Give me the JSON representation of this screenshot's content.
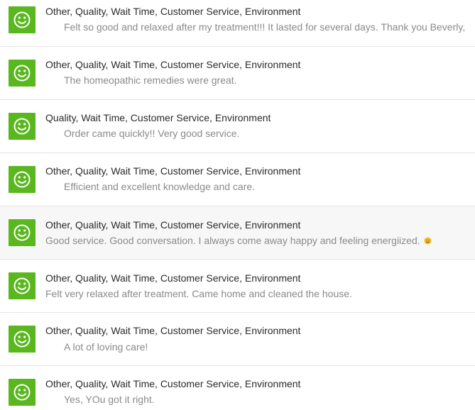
{
  "colors": {
    "smiley_bg": "#5ab71f",
    "category_text": "#2b2b2b",
    "comment_text": "#8a8a8a",
    "divider": "#e4e4e4"
  },
  "feedback": [
    {
      "icon": "smiley-face-icon",
      "categories": "Other, Quality, Wait Time, Customer Service, Environment",
      "comment": "Felt so good and relaxed after my treatment!!! It lasted for several days. Thank you Beverly,"
    },
    {
      "icon": "smiley-face-icon",
      "categories": "Other, Quality, Wait Time, Customer Service, Environment",
      "comment": "The homeopathic remedies were great."
    },
    {
      "icon": "smiley-face-icon",
      "categories": "Quality, Wait Time, Customer Service, Environment",
      "comment": "Order came quickly!! Very good service."
    },
    {
      "icon": "smiley-face-icon",
      "categories": "Other, Quality, Wait Time, Customer Service, Environment",
      "comment": "Efficient and excellent knowledge and care."
    },
    {
      "icon": "smiley-face-icon",
      "categories": "Other, Quality, Wait Time, Customer Service, Environment",
      "comment": "Good service. Good conversation. I always come away happy and feeling energiized."
    },
    {
      "icon": "smiley-face-icon",
      "categories": "Other, Quality, Wait Time, Customer Service, Environment",
      "comment": "Felt very relaxed after treatment. Came home and cleaned the house."
    },
    {
      "icon": "smiley-face-icon",
      "categories": "Other, Quality, Wait Time, Customer Service, Environment",
      "comment": "A lot of loving care!"
    },
    {
      "icon": "smiley-face-icon",
      "categories": "Other, Quality, Wait Time, Customer Service, Environment",
      "comment": "Yes, YOu got it right."
    }
  ]
}
